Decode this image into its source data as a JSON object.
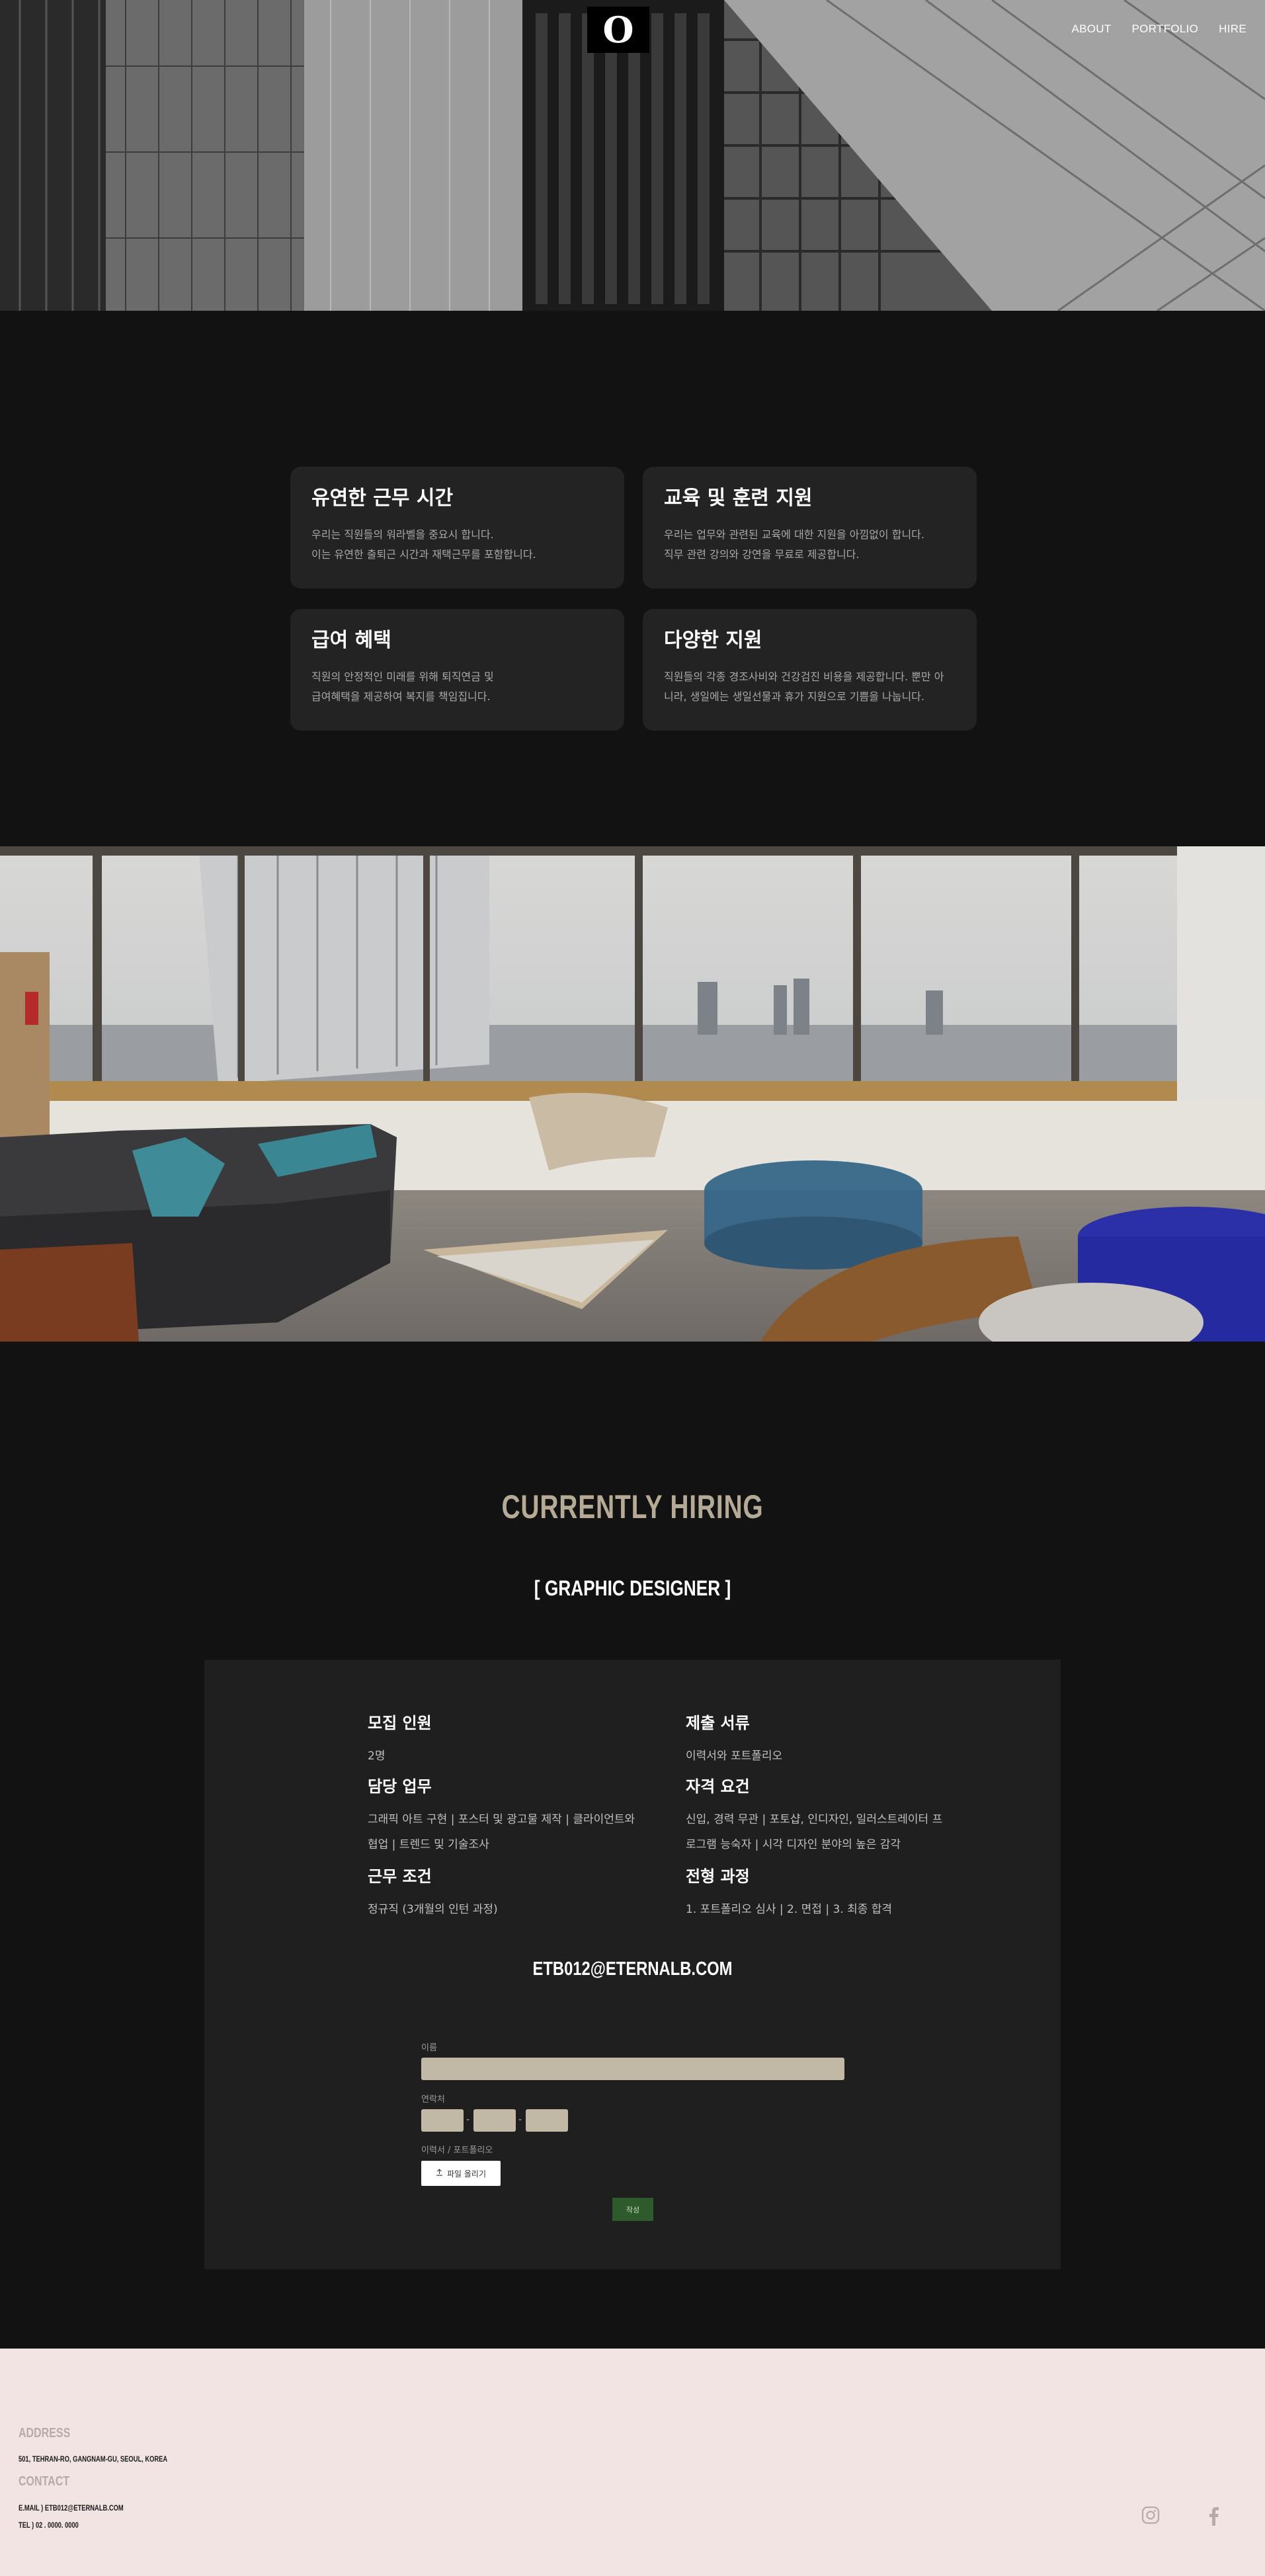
{
  "brand": {
    "logo_letter": "O"
  },
  "nav": {
    "items": [
      "ABOUT",
      "PORTFOLIO",
      "HIRE"
    ]
  },
  "benefits": [
    {
      "title": "유연한 근무 시간",
      "lines": [
        "우리는 직원들의 워라벨을 중요시 합니다.",
        "이는 유연한 출퇴근 시간과 재택근무를 포함합니다."
      ]
    },
    {
      "title": "교육 및 훈련 지원",
      "lines": [
        "우리는 업무와 관련된 교육에 대한 지원을 아낌없이 합니다.",
        "직무 관련 강의와 강연을 무료로 제공합니다."
      ]
    },
    {
      "title": "급여 혜택",
      "lines": [
        "직원의 안정적인 미래를 위해 퇴직연금 및",
        "급여혜택을 제공하여 복지를 책임집니다."
      ]
    },
    {
      "title": "다양한 지원",
      "lines": [
        "직원들의 각종 경조사비와 건강검진 비용을 제공합니다. 뿐만 아",
        "니라, 생일에는 생일선물과 휴가 지원으로 기쁨을 나눕니다."
      ]
    }
  ],
  "hiring": {
    "title": "CURRENTLY HIRING",
    "role": "[ GRAPHIC DESIGNER ]",
    "info": [
      {
        "title": "모집 인원",
        "lines": [
          "2명"
        ]
      },
      {
        "title": "제출 서류",
        "lines": [
          "이력서와 포트폴리오"
        ]
      },
      {
        "title": "담당 업무",
        "lines": [
          "그래픽 아트 구현  |  포스터 및 광고물 제작  |  클라이언트와",
          "협업  |  트렌드 및 기술조사"
        ]
      },
      {
        "title": "자격 요건",
        "lines": [
          "신입, 경력 무관  |  포토샵, 인디자인, 일러스트레이터 프",
          "로그램 능숙자  |  시각 디자인 분야의 높은 감각"
        ]
      },
      {
        "title": "근무 조건",
        "lines": [
          "정규직 (3개월의 인턴 과정)"
        ]
      },
      {
        "title": "전형 과정",
        "lines": [
          "1. 포트폴리오 심사  |  2. 면접  |  3. 최종 합격"
        ]
      }
    ],
    "email": "ETB012@ETERNALB.COM"
  },
  "form": {
    "name_label": "이름",
    "phone_label": "연락처",
    "phone_sep": "-",
    "file_label": "이력서 / 포트폴리오",
    "upload_label": "파일 올리기",
    "submit_label": "작성"
  },
  "footer": {
    "address_heading": "ADDRESS",
    "address": "501, TEHRAN-RO, GANGNAM-GU, SEOUL, KOREA",
    "contact_heading": "CONTACT",
    "email_line": "E.MAIL ) ETB012@ETERNALB.COM",
    "tel_line": "TEL ) 02 . 0000. 0000"
  }
}
